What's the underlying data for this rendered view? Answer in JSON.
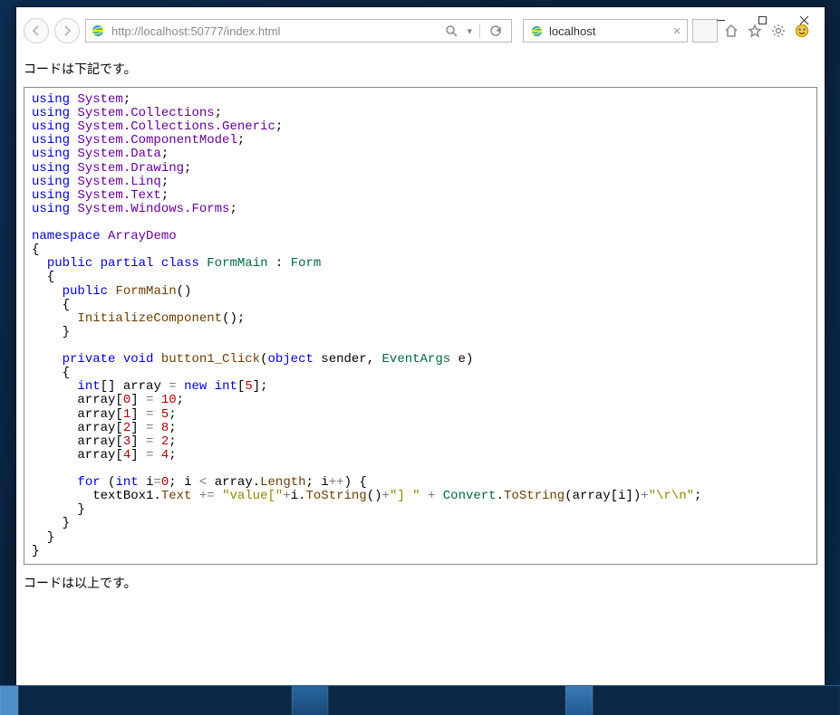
{
  "window_controls": {
    "minimize": "—",
    "maximize": "▢",
    "close": "✕"
  },
  "addressbar": {
    "url_prefix": "http://",
    "url_host": "localhost:",
    "url_port": "50777",
    "url_path": "/index.html"
  },
  "tab": {
    "title": "localhost"
  },
  "page": {
    "text_before": "コードは下記です。",
    "text_after": "コードは以上です。",
    "code": {
      "usings": [
        "System",
        "System.Collections",
        "System.Collections.Generic",
        "System.ComponentModel",
        "System.Data",
        "System.Drawing",
        "System.Linq",
        "System.Text",
        "System.Windows.Forms"
      ],
      "namespace": "ArrayDemo",
      "class_name": "FormMain",
      "base_class": "Form",
      "ctor_name": "FormMain",
      "ctor_call": "InitializeComponent",
      "handler_name": "button1_Click",
      "handler_arg1_type": "object",
      "handler_arg1_name": "sender",
      "handler_arg2_type": "EventArgs",
      "handler_arg2_name": "e",
      "array_size": 5,
      "array_init": [
        {
          "index": 0,
          "value": 10
        },
        {
          "index": 1,
          "value": 5
        },
        {
          "index": 2,
          "value": 8
        },
        {
          "index": 3,
          "value": 2
        },
        {
          "index": 4,
          "value": 4
        }
      ],
      "textbox": "textBox1",
      "string_literal_1": "\"value[\"",
      "string_literal_2": "\"] \"",
      "string_literal_3": "\"\\r\\n\"",
      "for_var": "i",
      "for_init": 0
    }
  }
}
